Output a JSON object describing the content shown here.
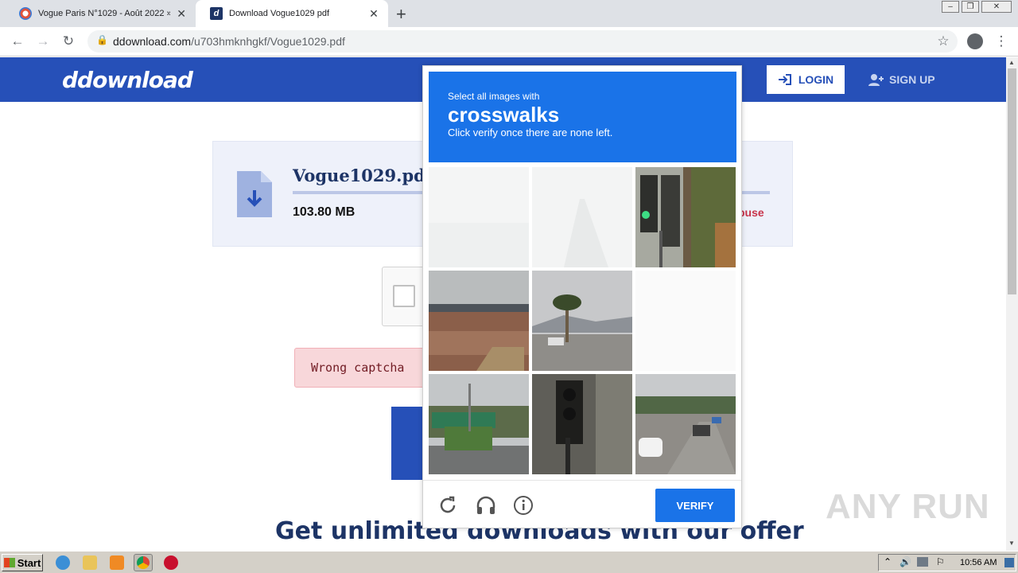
{
  "browser": {
    "tabs": [
      {
        "title": "Vogue Paris N°1029 - Août 2022 » Tél",
        "active": false
      },
      {
        "title": "Download Vogue1029 pdf",
        "active": true
      }
    ],
    "new_tab": "+",
    "url_domain": "ddownload.com",
    "url_path": "/u703hmknhgkf/Vogue1029.pdf"
  },
  "site": {
    "logo": "ddownload",
    "login": "LOGIN",
    "signup": "SIGN UP",
    "file_name": "Vogue1029.pdf",
    "file_size": "103.80 MB",
    "abuse": "buse",
    "wrong_captcha": "Wrong captcha",
    "offer_heading": "Get unlimited downloads with our offer"
  },
  "captcha": {
    "prompt_pre": "Select all images with",
    "prompt_word": "crosswalks",
    "prompt_post": "Click verify once there are none left.",
    "verify": "VERIFY",
    "tiles": [
      {
        "scene": "blank-fading"
      },
      {
        "scene": "road-blank"
      },
      {
        "scene": "traffic-light-trees"
      },
      {
        "scene": "parking-lot"
      },
      {
        "scene": "palm-tree-hills"
      },
      {
        "scene": "blank"
      },
      {
        "scene": "highway-signs"
      },
      {
        "scene": "traffic-light-dark"
      },
      {
        "scene": "highway-cars"
      }
    ]
  },
  "watermark": "ANY RUN",
  "taskbar": {
    "start": "Start",
    "clock": "10:56 AM"
  },
  "colors": {
    "brand_blue": "#2650b8",
    "captcha_blue": "#1a73e8"
  }
}
